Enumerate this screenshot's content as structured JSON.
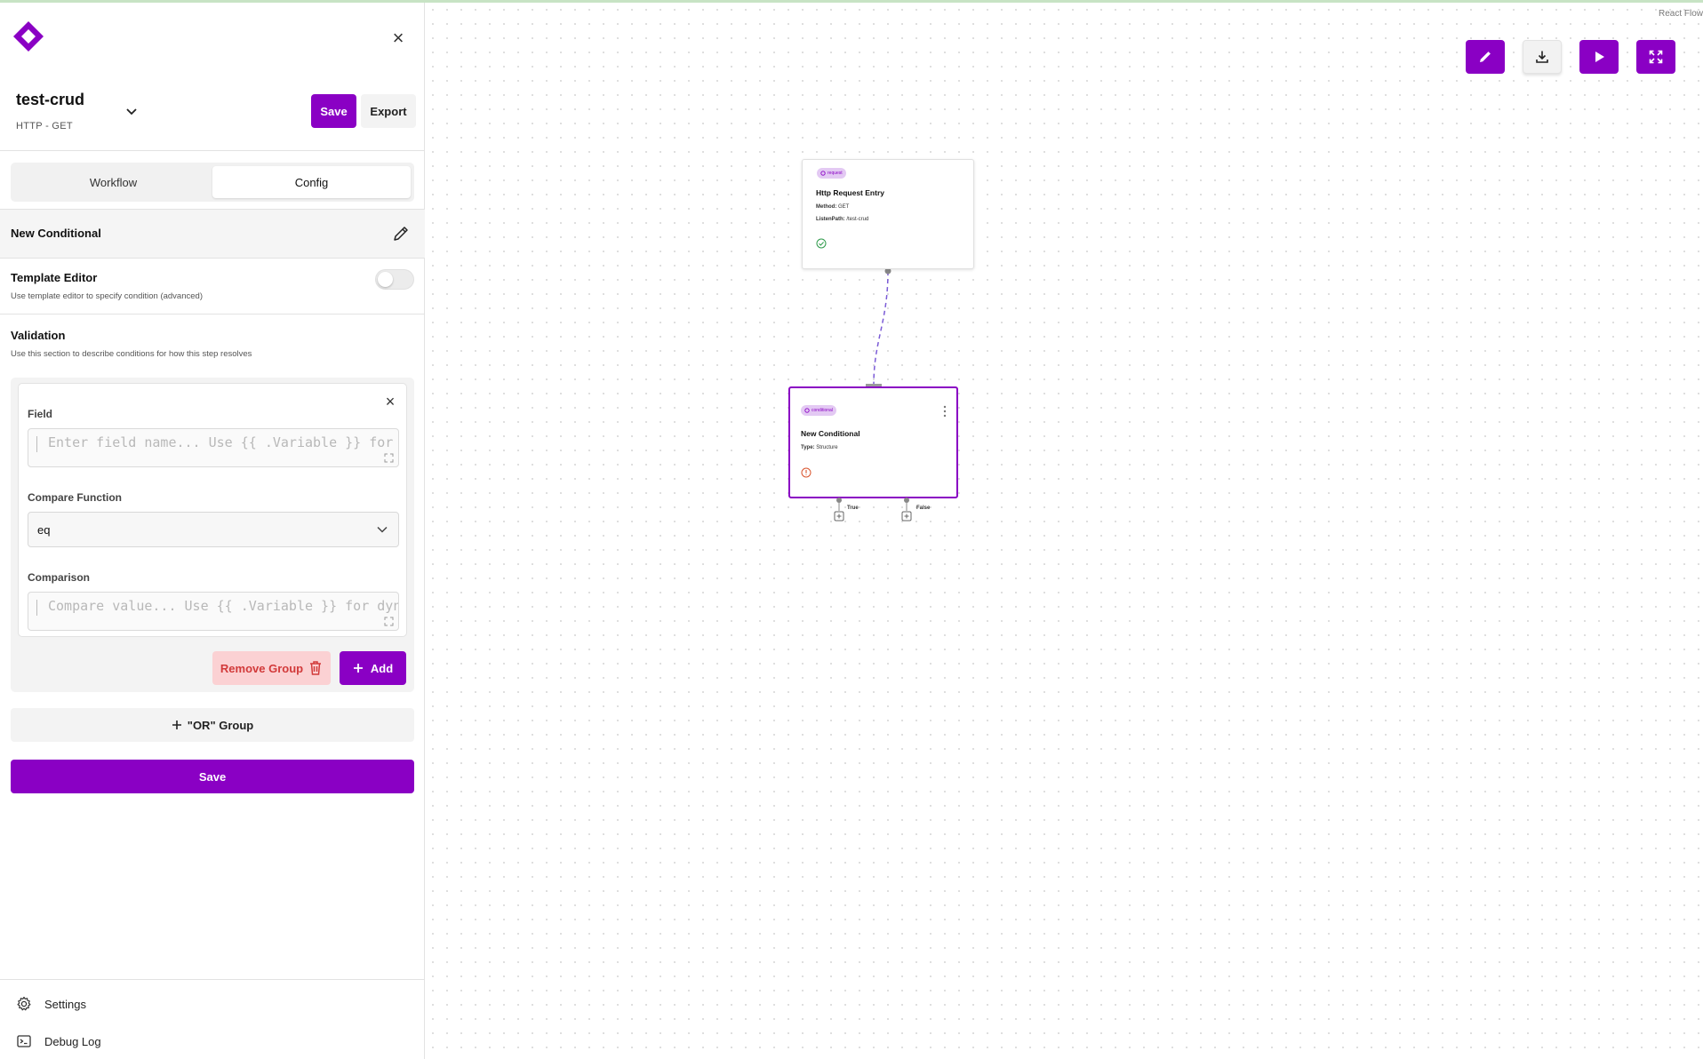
{
  "sidebar": {
    "project": {
      "name": "test-crud",
      "subtitle": "HTTP - GET"
    },
    "save_label": "Save",
    "export_label": "Export",
    "tabs": [
      {
        "label": "Workflow"
      },
      {
        "label": "Config"
      }
    ],
    "step": {
      "name": "New Conditional"
    },
    "template_editor": {
      "title": "Template Editor",
      "desc": "Use template editor to specify condition (advanced)",
      "enabled": false
    },
    "validation": {
      "title": "Validation",
      "desc": "Use this section to describe conditions for how this step resolves",
      "field_label": "Field",
      "field_placeholder": "Enter field name... Use {{ .Variable }} for dynamic",
      "compare_label": "Compare Function",
      "compare_value": "eq",
      "comparison_label": "Comparison",
      "comparison_placeholder": "Compare value... Use {{ .Variable }} for dynamic",
      "remove_group_label": "Remove Group",
      "add_label": "Add"
    },
    "or_group_label": "\"OR\" Group",
    "save_main_label": "Save",
    "nav": [
      {
        "label": "Settings",
        "icon": "gear-icon"
      },
      {
        "label": "Debug Log",
        "icon": "terminal-icon"
      }
    ]
  },
  "canvas": {
    "attribution": "React Flow",
    "toolbar": [
      "edit-icon",
      "download-icon",
      "play-icon",
      "fullscreen-icon"
    ],
    "nodes": [
      {
        "tag": "request",
        "title": "Http Request Entry",
        "fields": [
          {
            "key": "Method:",
            "value": "GET"
          },
          {
            "key": "ListenPath:",
            "value": "/test-crud"
          }
        ],
        "status": "success"
      },
      {
        "tag": "conditional",
        "title": "New Conditional",
        "fields": [
          {
            "key": "Type:",
            "value": "Structure"
          }
        ],
        "status": "warning",
        "outputs": [
          "True",
          "False"
        ]
      }
    ]
  },
  "colors": {
    "accent": "#8a00c4",
    "danger_bg": "#fbd1d3",
    "danger_text": "#d23a3a",
    "success": "#2e9a4a",
    "warning": "#d9532c"
  }
}
